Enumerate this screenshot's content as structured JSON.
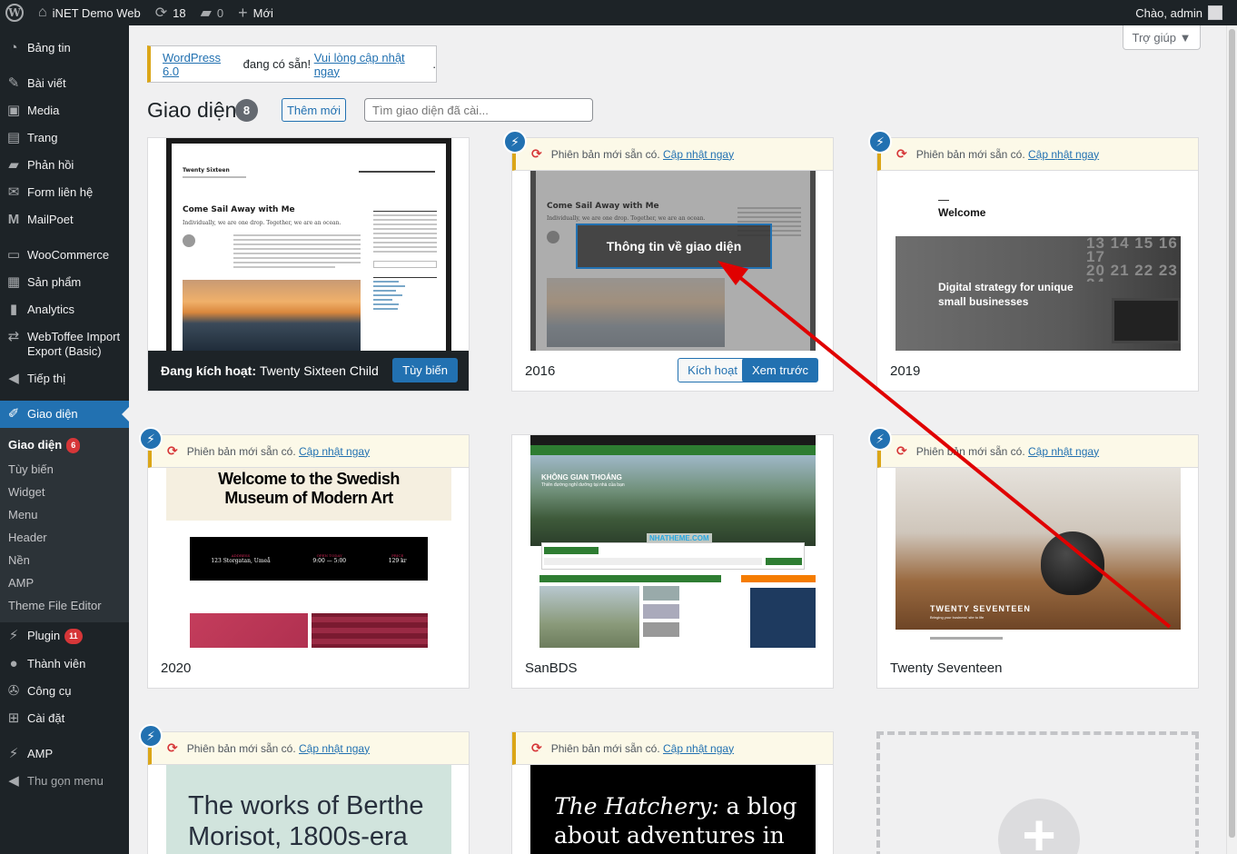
{
  "adminbar": {
    "site_name": "iNET Demo Web",
    "updates_count": "18",
    "comments_count": "0",
    "new_label": "Mới",
    "greeting": "Chào, admin"
  },
  "sidebar": {
    "items": [
      {
        "label": "Bảng tin",
        "icon": "dashboard-icon"
      },
      {
        "label": "Bài viết",
        "icon": "pin-icon"
      },
      {
        "label": "Media",
        "icon": "media-icon"
      },
      {
        "label": "Trang",
        "icon": "page-icon"
      },
      {
        "label": "Phản hồi",
        "icon": "comment-icon"
      },
      {
        "label": "Form liên hệ",
        "icon": "mail-icon"
      },
      {
        "label": "MailPoet",
        "icon": "mailpoet-icon"
      },
      {
        "label": "WooCommerce",
        "icon": "woo-icon"
      },
      {
        "label": "Sản phẩm",
        "icon": "archive-icon"
      },
      {
        "label": "Analytics",
        "icon": "chart-icon"
      },
      {
        "label": "WebToffee Import Export (Basic)",
        "icon": "import-export-icon"
      },
      {
        "label": "Tiếp thị",
        "icon": "megaphone-icon"
      },
      {
        "label": "Giao diện",
        "icon": "brush-icon"
      },
      {
        "label": "Plugin",
        "icon": "plugin-icon",
        "badge": "11"
      },
      {
        "label": "Thành viên",
        "icon": "users-icon"
      },
      {
        "label": "Công cụ",
        "icon": "tools-icon"
      },
      {
        "label": "Cài đặt",
        "icon": "settings-icon"
      },
      {
        "label": "AMP",
        "icon": "amp-icon"
      },
      {
        "label": "Thu gọn menu",
        "icon": "collapse-icon"
      }
    ],
    "submenu": [
      {
        "label": "Giao diện",
        "badge": "6"
      },
      {
        "label": "Tùy biến"
      },
      {
        "label": "Widget"
      },
      {
        "label": "Menu"
      },
      {
        "label": "Header"
      },
      {
        "label": "Nền"
      },
      {
        "label": "AMP"
      },
      {
        "label": "Theme File Editor"
      }
    ]
  },
  "help_tab": "Trợ giúp ▼",
  "notice": {
    "link1": "WordPress 6.0",
    "text": " đang có sẵn! ",
    "link2": "Vui lòng cập nhật ngay",
    "end": "."
  },
  "header": {
    "title": "Giao diện",
    "count": "8",
    "add_new": "Thêm mới",
    "search_placeholder": "Tìm giao diện đã cài..."
  },
  "update": {
    "text": "Phiên bản mới sẵn có.",
    "link": "Cập nhật ngay"
  },
  "themes": {
    "active": {
      "label_bold": "Đang kích hoạt:",
      "label_name": "Twenty Sixteen Child",
      "customize": "Tùy biến",
      "preview_site_title": "Twenty Sixteen",
      "preview_post_title": "Come Sail Away with Me",
      "preview_excerpt": "Individually, we are one drop. Together, we are an ocean."
    },
    "t2016": {
      "name": "2016",
      "overlay": "Thông tin về giao diện",
      "activate": "Kích hoạt",
      "preview": "Xem trước",
      "preview_post_title": "Come Sail Away with Me",
      "preview_excerpt": "Individually, we are one drop. Together, we are an ocean."
    },
    "t2019": {
      "name": "2019",
      "welcome": "Welcome",
      "tagline": "Digital strategy for unique small businesses"
    },
    "t2020": {
      "name": "2020",
      "hero": "Welcome to the Swedish Museum of Modern Art",
      "address_label": "ADDRESS",
      "address": "123 Storgatan, Umeå",
      "open_label": "OPEN TODAY",
      "open": "9:00 — 5:00",
      "price_label": "PRICE",
      "price": "129 kr"
    },
    "sanbds": {
      "name": "SanBDS",
      "banner": "KHÔNG GIAN THOÁNG",
      "banner_sub": "Thiên đường nghỉ dưỡng tại nhà của bạn",
      "watermark": "NHATHEME.COM"
    },
    "t2017": {
      "name": "Twenty Seventeen",
      "overlay_title": "TWENTY SEVENTEEN",
      "overlay_sub": "Bringing your business' site to life"
    },
    "t2021": {
      "hero": "The works of Berthe Morisot, 1800s-era"
    },
    "t2022": {
      "hero_italic": "The Hatchery:",
      "hero_rest": " a blog about adventures in"
    }
  },
  "colors": {
    "admin_dark": "#1d2327",
    "primary": "#2271b1",
    "warning": "#dba617",
    "error": "#d63638",
    "annotation_arrow": "#e00000"
  }
}
